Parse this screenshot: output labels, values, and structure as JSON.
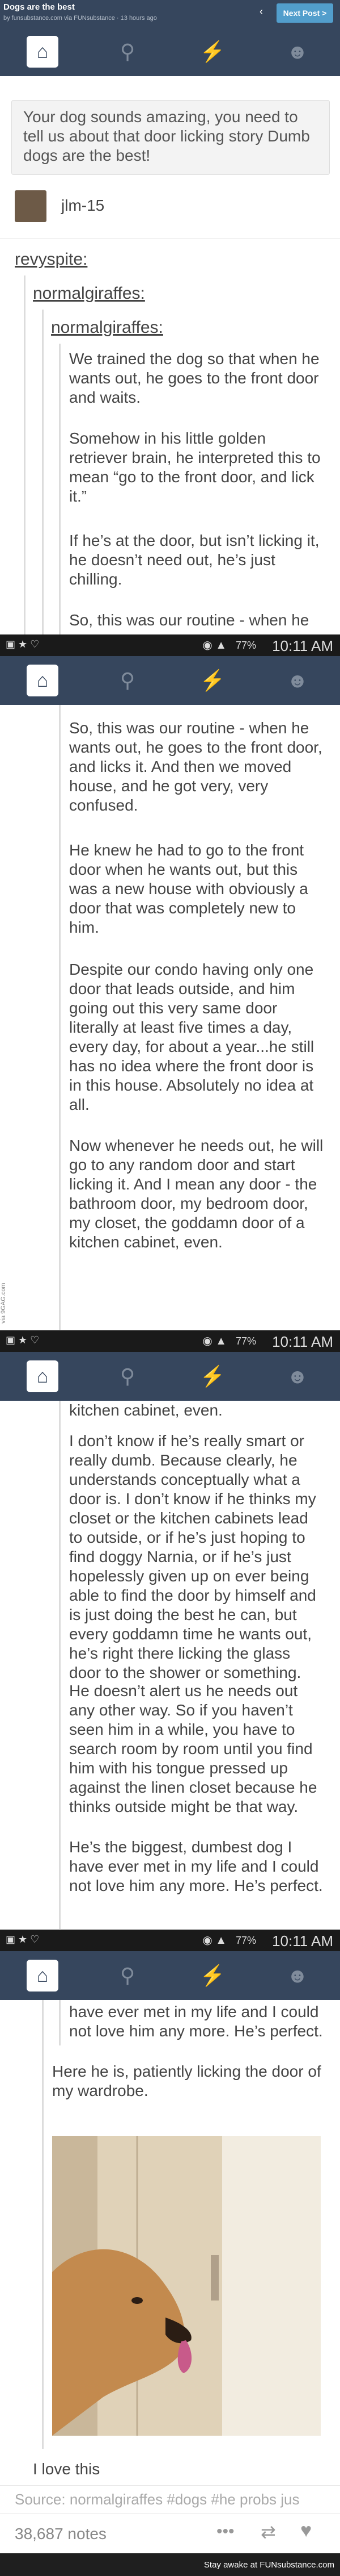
{
  "topbar": {
    "title": "Dogs are the best",
    "subtitle": "by funsubstance.com via FUNsubstance · 13 hours ago",
    "next_label": "Next Post >"
  },
  "status": {
    "battery": "77%",
    "time": "10:11 AM"
  },
  "reply": {
    "text": "Your dog sounds amazing, you need to tell us about that door licking story Dumb dogs are the best!",
    "user": "jlm-15"
  },
  "users": {
    "u1": "revyspite:",
    "u2": "normalgiraffes:",
    "u3": "normalgiraffes:"
  },
  "panel1": {
    "p1": "We trained the dog so that when he wants out, he goes to the front door and waits.",
    "p2": "Somehow in his little golden retriever brain, he interpreted this to mean “go to the front door, and lick it.”",
    "p3": "If he’s at the door, but isn’t licking it, he doesn’t need out, he’s just chilling.",
    "p4": "So, this was our routine - when he"
  },
  "panel2": {
    "p1": "So, this was our routine - when he wants out, he goes to the front door, and licks it. And then we moved house, and he got very, very confused.",
    "p2": "He knew he had to go to the front door when he wants out, but this was a new house with obviously a door that was completely new to him.",
    "p3": "Despite our condo having only one door that leads outside, and him going out this very same door literally at least five times a day, every day, for about a year...he still has no idea where the front door is in this house. Absolutely no idea at all.",
    "p4": "Now whenever he needs out, he will go to any random door and start licking it. And I mean any door - the bathroom door, my bedroom door, my closet, the goddamn door of a kitchen cabinet, even."
  },
  "panel3": {
    "p0": "kitchen cabinet, even.",
    "p1": "I don’t know if he’s really smart or really dumb. Because clearly, he understands conceptually what a door is. I don’t know if he thinks my closet or the kitchen cabinets lead to outside, or if he’s just hoping to find doggy Narnia, or if he’s just hopelessly given up on ever being able to find the door by himself and is just doing the best he can, but every goddamn time he wants out, he’s right there licking the glass door to the shower or something.",
    "p2": "He doesn’t alert us he needs out any other way. So if you haven’t seen him in a while, you have to search room by room until you find him with his tongue pressed up against the linen closet because he thinks outside might be that way.",
    "p3": "He’s the biggest, dumbest dog I have ever met in my life and I could not love him any more. He’s perfect."
  },
  "panel4": {
    "p0": "have ever met in my life and I could not love him any more. He’s perfect.",
    "p1": "Here he is, patiently licking the door of my wardrobe.",
    "p2": "I love this",
    "source": "Source: normalgiraffes  #dogs  #he probs jus",
    "notes": "38,687 notes"
  },
  "watermark": "via 9GAG.com",
  "footer": "Stay awake at FUNsubstance.com",
  "colors": {
    "tumblr_navy": "#36465d",
    "accent": "#529ecc"
  }
}
